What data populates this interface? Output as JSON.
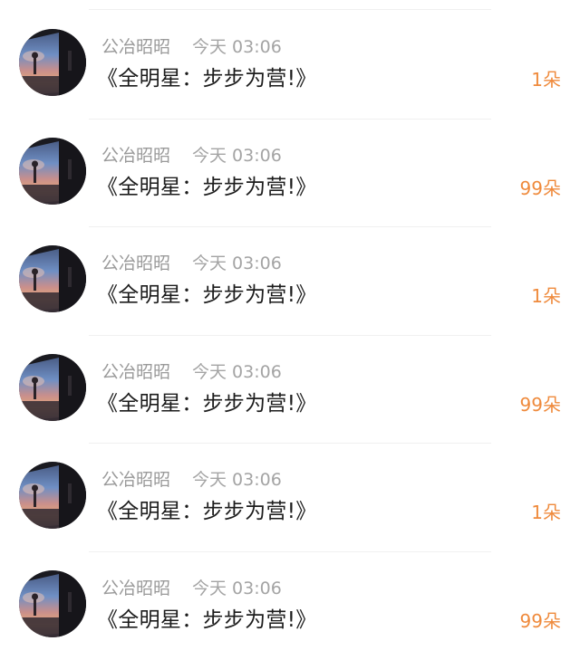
{
  "colors": {
    "username": "#9a9a9a",
    "timestamp": "#a4a4a4",
    "title": "#1c1c1c",
    "count_accent": "#ef8a3c",
    "divider": "#f0f0f0"
  },
  "items": [
    {
      "username": "公冶昭昭",
      "timestamp": "今天 03:06",
      "title": "《全明星：步步为营!》",
      "count": "1朵",
      "avatar_icon": "sunset-silhouette-avatar"
    },
    {
      "username": "公冶昭昭",
      "timestamp": "今天 03:06",
      "title": "《全明星：步步为营!》",
      "count": "99朵",
      "avatar_icon": "sunset-silhouette-avatar"
    },
    {
      "username": "公冶昭昭",
      "timestamp": "今天 03:06",
      "title": "《全明星：步步为营!》",
      "count": "1朵",
      "avatar_icon": "sunset-silhouette-avatar"
    },
    {
      "username": "公冶昭昭",
      "timestamp": "今天 03:06",
      "title": "《全明星：步步为营!》",
      "count": "99朵",
      "avatar_icon": "sunset-silhouette-avatar"
    },
    {
      "username": "公冶昭昭",
      "timestamp": "今天 03:06",
      "title": "《全明星：步步为营!》",
      "count": "1朵",
      "avatar_icon": "sunset-silhouette-avatar"
    },
    {
      "username": "公冶昭昭",
      "timestamp": "今天 03:06",
      "title": "《全明星：步步为营!》",
      "count": "99朵",
      "avatar_icon": "sunset-silhouette-avatar"
    }
  ]
}
